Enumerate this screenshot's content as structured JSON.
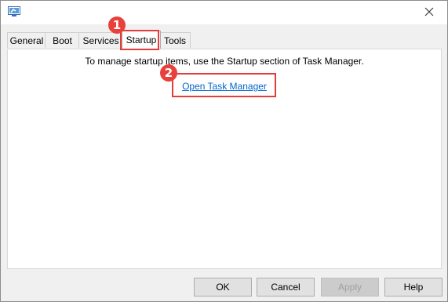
{
  "tabs": [
    {
      "label": "General"
    },
    {
      "label": "Boot"
    },
    {
      "label": "Services"
    },
    {
      "label": "Startup"
    },
    {
      "label": "Tools"
    }
  ],
  "startup": {
    "message": "To manage startup items, use the Startup section of Task Manager.",
    "link_label": "Open Task Manager"
  },
  "buttons": {
    "ok": "OK",
    "cancel": "Cancel",
    "apply": "Apply",
    "help": "Help"
  },
  "annotations": {
    "marker_1": "1",
    "marker_2": "2",
    "color": "#e33c3c"
  },
  "icons": {
    "app": "msconfig-app-icon",
    "close": "close-icon"
  }
}
